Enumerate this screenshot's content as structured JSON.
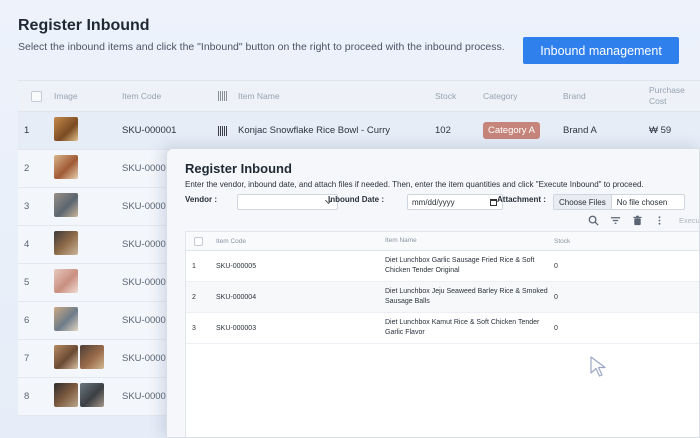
{
  "page": {
    "title": "Register Inbound",
    "description": "Select the inbound items and click the \"Inbound\" button on the right to proceed with the inbound process.",
    "inbound_button": "Inbound management"
  },
  "table": {
    "headers": {
      "image": "Image",
      "item_code": "Item Code",
      "item_name": "Item Name",
      "stock": "Stock",
      "category": "Category",
      "brand": "Brand",
      "purchase_cost": "Purchase Cost"
    },
    "rows": [
      {
        "no": "1",
        "code": "SKU-000001",
        "name": "Konjac Snowflake Rice Bowl - Curry",
        "stock": "102",
        "category": "Category A",
        "brand": "Brand A",
        "cost": "₩ 59"
      },
      {
        "no": "2",
        "code": "SKU-00000",
        "name": "",
        "stock": "",
        "category": "",
        "brand": "",
        "cost": ""
      },
      {
        "no": "3",
        "code": "SKU-00000",
        "name": "",
        "stock": "",
        "category": "",
        "brand": "",
        "cost": ""
      },
      {
        "no": "4",
        "code": "SKU-00000",
        "name": "",
        "stock": "",
        "category": "",
        "brand": "",
        "cost": ""
      },
      {
        "no": "5",
        "code": "SKU-00000",
        "name": "",
        "stock": "",
        "category": "",
        "brand": "",
        "cost": ""
      },
      {
        "no": "6",
        "code": "SKU-00000",
        "name": "",
        "stock": "",
        "category": "",
        "brand": "",
        "cost": ""
      },
      {
        "no": "7",
        "code": "SKU-00000",
        "name": "",
        "stock": "",
        "category": "",
        "brand": "",
        "cost": ""
      },
      {
        "no": "8",
        "code": "SKU-00000",
        "name": "",
        "stock": "",
        "category": "",
        "brand": "",
        "cost": ""
      }
    ]
  },
  "modal": {
    "title": "Register Inbound",
    "description": "Enter the vendor, inbound date, and attach files if needed. Then, enter the item quantities and click \"Execute Inbound\" to proceed.",
    "vendor_label": "Vendor :",
    "vendor_value": "",
    "date_label": "Inbound Date :",
    "date_placeholder": "mm/dd/yyyy",
    "attachment_label": "Attachment :",
    "choose_files": "Choose Files",
    "no_file": "No file chosen",
    "execute_label": "Execu",
    "table_headers": {
      "item_code": "Item Code",
      "item_name": "Item Name",
      "stock": "Stock"
    },
    "rows": [
      {
        "no": "1",
        "code": "SKU-000005",
        "name": "Diet Lunchbox Garlic Sausage Fried Rice & Soft Chicken Tender Original",
        "stock": "0"
      },
      {
        "no": "2",
        "code": "SKU-000004",
        "name": "Diet Lunchbox Jeju Seaweed Barley Rice & Smoked Sausage Balls",
        "stock": "0"
      },
      {
        "no": "3",
        "code": "SKU-000003",
        "name": "Diet Lunchbox Kamut Rice & Soft Chicken Tender Garlic Flavor",
        "stock": "0"
      }
    ]
  },
  "colors": {
    "accent": "#2f80ed",
    "category_badge": "#c6857a"
  }
}
